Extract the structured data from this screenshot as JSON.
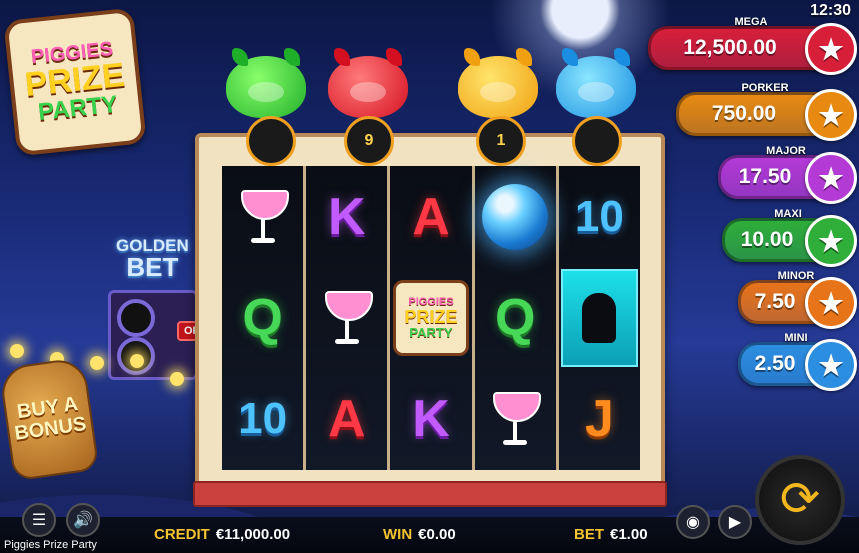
{
  "clock": "12:30",
  "logo": {
    "line1": "PIGGIES",
    "line2": "PRIZE",
    "line3": "PARTY"
  },
  "golden_bet": {
    "line1": "GOLDEN",
    "line2": "BET",
    "toggle": "OFF"
  },
  "buy_bonus": {
    "line1": "BUY A",
    "line2": "BONUS"
  },
  "pig_counters": [
    "",
    "9",
    "1",
    ""
  ],
  "reels": [
    [
      "cocktail",
      "Q",
      "10"
    ],
    [
      "K",
      "cocktail",
      "A"
    ],
    [
      "A",
      "scatter",
      "K"
    ],
    [
      "disco",
      "Q",
      "cocktail"
    ],
    [
      "10",
      "silhouette",
      "J"
    ]
  ],
  "scatter": {
    "line1": "PIGGIES",
    "line2": "PRIZE",
    "line3": "PARTY"
  },
  "jackpots": [
    {
      "label": "MEGA",
      "value": "12,500.00",
      "color": "#d81f3a"
    },
    {
      "label": "PORKER",
      "value": "750.00",
      "color": "#e88a12"
    },
    {
      "label": "MAJOR",
      "value": "17.50",
      "color": "#b43ad6"
    },
    {
      "label": "MAXI",
      "value": "10.00",
      "color": "#2fae3a"
    },
    {
      "label": "MINOR",
      "value": "7.50",
      "color": "#e8741a"
    },
    {
      "label": "MINI",
      "value": "2.50",
      "color": "#2c8ee0"
    }
  ],
  "bottom_bar": {
    "credit_label": "CREDIT",
    "credit_value": "€11,000.00",
    "win_label": "WIN",
    "win_value": "€0.00",
    "bet_label": "BET",
    "bet_value": "€1.00",
    "game_name": "Piggies Prize Party"
  },
  "icons": {
    "menu": "menu-icon",
    "sound": "speaker-icon",
    "coins": "coins-icon",
    "autoplay": "autoplay-icon",
    "spin": "spin-icon"
  }
}
